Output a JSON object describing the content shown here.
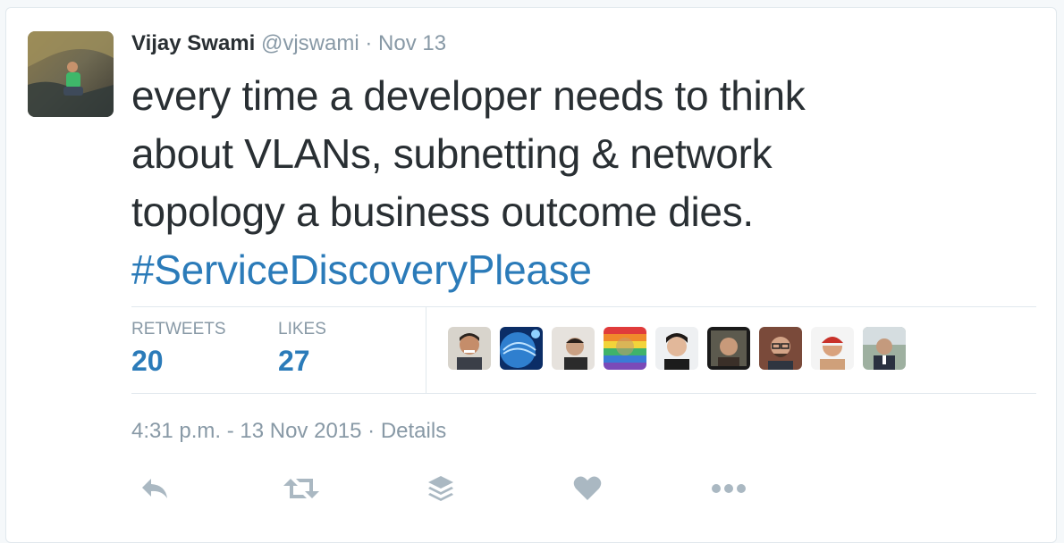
{
  "tweet": {
    "author": {
      "name": "Vijay Swami",
      "handle": "@vjswami",
      "separator": "·",
      "date": "Nov 13",
      "avatar_icon": "user-avatar-photo"
    },
    "text_lines": [
      "every time a developer needs to think",
      "about VLANs, subnetting & network",
      "topology a business outcome dies."
    ],
    "hashtag": "#ServiceDiscoveryPlease",
    "stats": {
      "retweets_label": "RETWEETS",
      "retweets_value": "20",
      "likes_label": "LIKES",
      "likes_value": "27"
    },
    "likers": [
      "liker-avatar-1",
      "liker-avatar-2",
      "liker-avatar-3",
      "liker-avatar-4",
      "liker-avatar-5",
      "liker-avatar-6",
      "liker-avatar-7",
      "liker-avatar-8",
      "liker-avatar-9"
    ],
    "timestamp": "4:31 p.m. - 13 Nov 2015",
    "details_separator": "·",
    "details_link": "Details",
    "actions": [
      "reply-icon",
      "retweet-icon",
      "buffer-icon",
      "like-icon",
      "more-icon"
    ]
  },
  "colors": {
    "text": "#292f33",
    "muted": "#8899a6",
    "link": "#2b7bb9",
    "border": "#e1e8ed",
    "icon": "#aab8c2"
  }
}
